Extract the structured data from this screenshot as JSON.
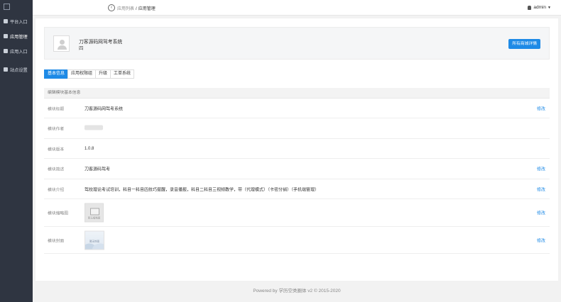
{
  "sidebar": {
    "items": [
      {
        "icon": "grid-icon",
        "label": "平台入口"
      },
      {
        "icon": "cloud-icon",
        "label": "应用管理"
      },
      {
        "icon": "cube-icon",
        "label": "应用入口"
      },
      {
        "icon": "gear-icon",
        "label": "站点设置"
      }
    ]
  },
  "header": {
    "breadcrumb_parent": "应用列表",
    "breadcrumb_sep": "/",
    "breadcrumb_current": "应用管理",
    "user": "admin"
  },
  "app": {
    "name": "刀客源码网驾考系统",
    "subtitle": "四",
    "buy_button": "所有商城详情"
  },
  "tabs": [
    "基本信息",
    "应用权限组",
    "升级",
    "工单系统"
  ],
  "panel": {
    "title": "编辑模块基本信息",
    "edit_label": "修改",
    "rows": [
      {
        "label": "模块标题",
        "value": "刀客源码网驾考系统"
      },
      {
        "label": "模块作者",
        "value": ""
      },
      {
        "label": "模块版本",
        "value": "1.0.8"
      },
      {
        "label": "模块简述",
        "value": "刀客源码驾考"
      },
      {
        "label": "模块介绍",
        "value": "驾校理论考试培训，科目一科目四技巧提醒，录音播报，科目二科目三视频教学，带（代理模式）（卡密分销）（手机端管理）"
      },
      {
        "label": "模块缩略图",
        "value": "暂无缩略图"
      },
      {
        "label": "模块封面",
        "value": "暂无封面"
      }
    ]
  },
  "footer": "Powered by 学历空类圈体 v2 © 2015-2020",
  "colors": {
    "sidebar": "#2f3541",
    "accent": "#1e8ae6"
  }
}
